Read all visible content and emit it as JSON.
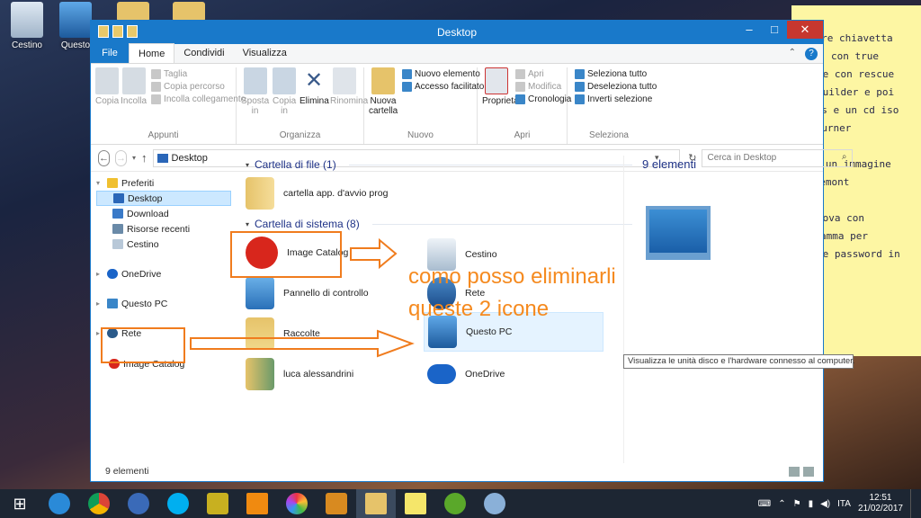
{
  "desktop": {
    "icons": [
      {
        "label": "Cestino",
        "icon": "recycle-bin-icon"
      },
      {
        "label": "Questo",
        "icon": "this-pc-icon"
      },
      {
        "label": "",
        "icon": "folder-icon"
      },
      {
        "label": "",
        "icon": "folder-icon"
      }
    ]
  },
  "sticky_note": {
    "lines": [
      "re fare chiavetta",
      "con true",
      "ge con rescue",
      "builder e poi",
      "fus e un cd iso",
      "dburner",
      "",
      "re un immagine",
      "daemont",
      "",
      "rova con",
      "amma per",
      "re password in"
    ]
  },
  "window": {
    "title": "Desktop",
    "tabs": {
      "file": "File",
      "home": "Home",
      "share": "Condividi",
      "view": "Visualizza"
    },
    "ribbon": {
      "clipboard": {
        "label": "Appunti",
        "copy": "Copia",
        "paste": "Incolla",
        "cut": "Taglia",
        "copy_path": "Copia percorso",
        "paste_shortcut": "Incolla collegamento"
      },
      "organize": {
        "label": "Organizza",
        "move_to": "Sposta in",
        "copy_to": "Copia in",
        "delete": "Elimina",
        "rename": "Rinomina"
      },
      "new": {
        "label": "Nuovo",
        "new_folder": "Nuova cartella",
        "new_item": "Nuovo elemento",
        "easy_access": "Accesso facilitato"
      },
      "open": {
        "label": "Apri",
        "properties": "Proprietà",
        "open": "Apri",
        "edit": "Modifica",
        "history": "Cronologia"
      },
      "select": {
        "label": "Seleziona",
        "select_all": "Seleziona tutto",
        "select_none": "Deseleziona tutto",
        "invert": "Inverti selezione"
      }
    },
    "address": {
      "path": "Desktop",
      "search_placeholder": "Cerca in Desktop"
    },
    "nav": {
      "favorites": "Preferiti",
      "fav_items": [
        "Desktop",
        "Download",
        "Risorse recenti",
        "Cestino"
      ],
      "onedrive": "OneDrive",
      "this_pc": "Questo PC",
      "network": "Rete",
      "image_catalog": "Image Catalog"
    },
    "content": {
      "section_files": "Cartella di file (1)",
      "startup_folder": "cartella app. d'avvio prog",
      "section_system": "Cartella di sistema (8)",
      "items": {
        "image_catalog": "Image Catalog",
        "recycle": "Cestino",
        "control_panel": "Pannello di controllo",
        "network": "Rete",
        "shortcuts": "Raccolte",
        "this_pc": "Questo PC",
        "user": "luca alessandrini",
        "onedrive": "OneDrive"
      }
    },
    "tooltip": "Visualizza le unità disco e l'hardware connesso al computer.",
    "details_count": "9 elementi",
    "status_count": "9 elementi"
  },
  "annotation": {
    "line1": "como posso eliminarli",
    "line2": "queste 2 icone",
    "color": "#f07c1e"
  },
  "taskbar": {
    "apps": [
      "start-icon",
      "internet-explorer-icon",
      "chrome-icon",
      "google-earth-icon",
      "skype-icon",
      "app-icon",
      "vlc-icon",
      "picasa-icon",
      "app-icon",
      "file-explorer-icon",
      "sticky-notes-icon",
      "utorrent-icon",
      "paint-icon"
    ],
    "lang": "ITA",
    "time": "12:51",
    "date": "21/02/2017"
  }
}
